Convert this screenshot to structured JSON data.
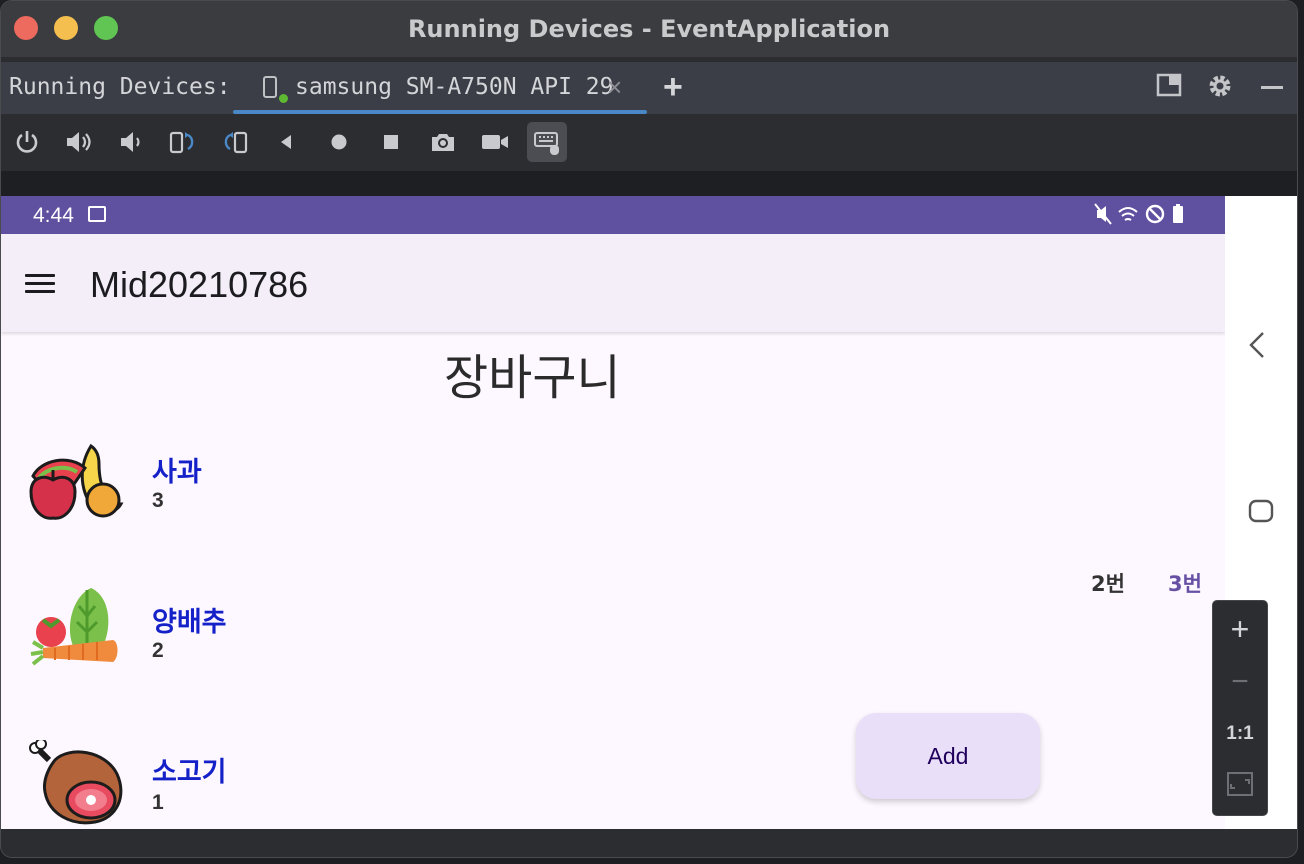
{
  "window": {
    "title": "Running Devices - EventApplication"
  },
  "tabbar": {
    "label": "Running Devices:",
    "tab_label": "samsung SM-A750N API 29",
    "close_glyph": "×",
    "add_glyph": "+"
  },
  "icons": {
    "toolbar": [
      "power-icon",
      "volume-up-icon",
      "volume-down-icon",
      "rotate-left-icon",
      "rotate-right-icon",
      "back-icon",
      "home-icon",
      "overview-icon",
      "camera-icon",
      "record-icon",
      "keyboard-mouse-icon"
    ],
    "tabbar_right": [
      "layout-icon",
      "gear-icon",
      "minimize-icon"
    ]
  },
  "android": {
    "status": {
      "time": "4:44"
    },
    "appbar": {
      "title": "Mid20210786"
    },
    "page_title": "장바구니",
    "items": [
      {
        "name": "사과",
        "qty": "3",
        "icon": "fruits-icon"
      },
      {
        "name": "양배추",
        "qty": "2",
        "icon": "vegetables-icon"
      },
      {
        "name": "소고기",
        "qty": "1",
        "icon": "meat-icon"
      }
    ],
    "tabs": [
      "2번",
      "3번"
    ],
    "fab_label": "Add",
    "colors": {
      "status_bar": "#5f519f",
      "item_name": "#1420c8",
      "fab_bg": "#e9dff8"
    }
  },
  "zoom": {
    "plus": "+",
    "minus": "−",
    "one_to_one": "1:1"
  }
}
